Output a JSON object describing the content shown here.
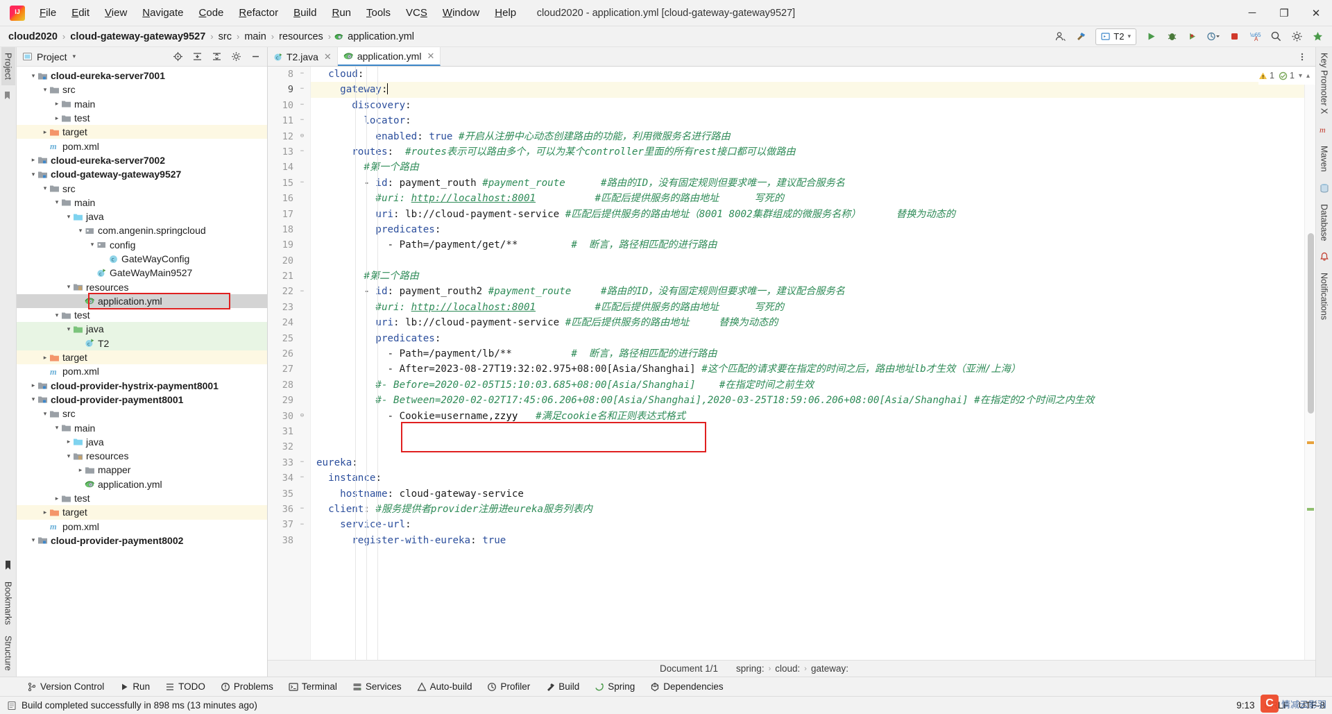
{
  "window": {
    "title": "cloud2020 - application.yml [cloud-gateway-gateway9527]",
    "minimize": "─",
    "maximize": "❐",
    "close": "✕"
  },
  "menubar": [
    {
      "label": "File"
    },
    {
      "label": "Edit"
    },
    {
      "label": "View"
    },
    {
      "label": "Navigate"
    },
    {
      "label": "Code"
    },
    {
      "label": "Refactor"
    },
    {
      "label": "Build"
    },
    {
      "label": "Run"
    },
    {
      "label": "Tools"
    },
    {
      "label": "VCS"
    },
    {
      "label": "Window"
    },
    {
      "label": "Help"
    }
  ],
  "breadcrumb": {
    "items": [
      "cloud2020",
      "cloud-gateway-gateway9527",
      "src",
      "main",
      "resources",
      "application.yml"
    ],
    "separator": "›"
  },
  "toolbar": {
    "run_config": "T2",
    "run_config_caret": "▾",
    "icons": [
      "user-icon",
      "hammer-icon",
      "run-icon",
      "debug-icon",
      "coverage-icon",
      "profile-icon",
      "stop-icon",
      "translate-icon",
      "search-icon",
      "settings-icon",
      "updates-icon"
    ]
  },
  "left_strip": {
    "tabs": [
      {
        "label": "Project",
        "active": true
      }
    ],
    "bottom_tabs": [
      {
        "label": "Bookmarks"
      },
      {
        "label": "Structure"
      }
    ]
  },
  "right_strip": {
    "tabs": [
      {
        "label": "Key Promoter X"
      },
      {
        "label": "Maven"
      },
      {
        "label": "Database"
      },
      {
        "label": "Notifications"
      }
    ]
  },
  "project_panel": {
    "title": "Project",
    "caret": "▾",
    "actions": [
      "locate-icon",
      "expand-all-icon",
      "collapse-all-icon",
      "settings-icon",
      "hide-icon"
    ],
    "tree": [
      {
        "indent": 1,
        "arrow": "⌄",
        "icon": "module-icon",
        "label": "cloud-eureka-server7001",
        "bold": true
      },
      {
        "indent": 2,
        "arrow": "⌄",
        "icon": "folder-gray",
        "label": "src"
      },
      {
        "indent": 3,
        "arrow": "›",
        "icon": "folder-gray",
        "label": "main"
      },
      {
        "indent": 3,
        "arrow": "›",
        "icon": "folder-gray",
        "label": "test"
      },
      {
        "indent": 2,
        "arrow": "›",
        "icon": "folder-orange",
        "label": "target",
        "highlight": "yellow"
      },
      {
        "indent": 2,
        "arrow": "",
        "icon": "maven-icon",
        "label": "pom.xml"
      },
      {
        "indent": 1,
        "arrow": "›",
        "icon": "module-icon",
        "label": "cloud-eureka-server7002",
        "bold": true
      },
      {
        "indent": 1,
        "arrow": "⌄",
        "icon": "module-icon",
        "label": "cloud-gateway-gateway9527",
        "bold": true
      },
      {
        "indent": 2,
        "arrow": "⌄",
        "icon": "folder-gray",
        "label": "src"
      },
      {
        "indent": 3,
        "arrow": "⌄",
        "icon": "folder-gray",
        "label": "main"
      },
      {
        "indent": 4,
        "arrow": "⌄",
        "icon": "folder-blue",
        "label": "java"
      },
      {
        "indent": 5,
        "arrow": "⌄",
        "icon": "package-icon",
        "label": "com.angenin.springcloud"
      },
      {
        "indent": 6,
        "arrow": "⌄",
        "icon": "package-icon",
        "label": "config"
      },
      {
        "indent": 7,
        "arrow": "",
        "icon": "class-icon",
        "label": "GateWayConfig"
      },
      {
        "indent": 6,
        "arrow": "",
        "icon": "class-run-icon",
        "label": "GateWayMain9527"
      },
      {
        "indent": 4,
        "arrow": "⌄",
        "icon": "resources-icon",
        "label": "resources"
      },
      {
        "indent": 5,
        "arrow": "",
        "icon": "yml-icon",
        "label": "application.yml",
        "selected": true,
        "boxed": true
      },
      {
        "indent": 3,
        "arrow": "⌄",
        "icon": "folder-gray",
        "label": "test"
      },
      {
        "indent": 4,
        "arrow": "⌄",
        "icon": "folder-green",
        "label": "java",
        "highlight": "green"
      },
      {
        "indent": 5,
        "arrow": "",
        "icon": "class-run-icon",
        "label": "T2",
        "highlight": "green"
      },
      {
        "indent": 2,
        "arrow": "›",
        "icon": "folder-orange",
        "label": "target",
        "highlight": "yellow"
      },
      {
        "indent": 2,
        "arrow": "",
        "icon": "maven-icon",
        "label": "pom.xml"
      },
      {
        "indent": 1,
        "arrow": "›",
        "icon": "module-icon",
        "label": "cloud-provider-hystrix-payment8001",
        "bold": true
      },
      {
        "indent": 1,
        "arrow": "⌄",
        "icon": "module-icon",
        "label": "cloud-provider-payment8001",
        "bold": true
      },
      {
        "indent": 2,
        "arrow": "⌄",
        "icon": "folder-gray",
        "label": "src"
      },
      {
        "indent": 3,
        "arrow": "⌄",
        "icon": "folder-gray",
        "label": "main"
      },
      {
        "indent": 4,
        "arrow": "›",
        "icon": "folder-blue",
        "label": "java"
      },
      {
        "indent": 4,
        "arrow": "⌄",
        "icon": "resources-icon",
        "label": "resources"
      },
      {
        "indent": 5,
        "arrow": "›",
        "icon": "folder-gray",
        "label": "mapper"
      },
      {
        "indent": 5,
        "arrow": "",
        "icon": "yml-icon",
        "label": "application.yml"
      },
      {
        "indent": 3,
        "arrow": "›",
        "icon": "folder-gray",
        "label": "test"
      },
      {
        "indent": 2,
        "arrow": "›",
        "icon": "folder-orange",
        "label": "target",
        "highlight": "yellow"
      },
      {
        "indent": 2,
        "arrow": "",
        "icon": "maven-icon",
        "label": "pom.xml"
      },
      {
        "indent": 1,
        "arrow": "⌄",
        "icon": "module-icon",
        "label": "cloud-provider-payment8002",
        "bold": true
      }
    ]
  },
  "editor": {
    "tabs": [
      {
        "label": "T2.java",
        "icon": "class-run-icon",
        "active": false,
        "close": "✕"
      },
      {
        "label": "application.yml",
        "icon": "yml-icon",
        "active": true,
        "close": "✕"
      }
    ],
    "inspections": {
      "warnings": "1",
      "weak_warnings": "1",
      "warn_icon": "warning-triangle",
      "weak_icon": "weak-warning"
    },
    "first_line_number": 8,
    "current_line": 9,
    "lines": [
      {
        "n": 8,
        "fold": "−",
        "text": "  cloud:",
        "cut_top": true,
        "spans": [
          {
            "t": "  ",
            "c": "v"
          },
          {
            "t": "cloud",
            "c": "k"
          },
          {
            "t": ":",
            "c": "v"
          }
        ]
      },
      {
        "n": 9,
        "fold": "−",
        "current": true,
        "spans": [
          {
            "t": "    ",
            "c": "v"
          },
          {
            "t": "gateway",
            "c": "k"
          },
          {
            "t": ":",
            "c": "v"
          },
          {
            "t": "",
            "c": "caret"
          }
        ]
      },
      {
        "n": 10,
        "fold": "−",
        "spans": [
          {
            "t": "      ",
            "c": "v"
          },
          {
            "t": "discovery",
            "c": "k"
          },
          {
            "t": ":",
            "c": "v"
          }
        ]
      },
      {
        "n": 11,
        "fold": "−",
        "spans": [
          {
            "t": "        ",
            "c": "v"
          },
          {
            "t": "locator",
            "c": "k"
          },
          {
            "t": ":",
            "c": "v"
          }
        ]
      },
      {
        "n": 12,
        "fold": "⊖",
        "spans": [
          {
            "t": "          ",
            "c": "v"
          },
          {
            "t": "enabled",
            "c": "k"
          },
          {
            "t": ": ",
            "c": "v"
          },
          {
            "t": "true",
            "c": "k"
          },
          {
            "t": " ",
            "c": "v"
          },
          {
            "t": "#开启从注册中心动态创建路由的功能，利用微服务名进行路由",
            "c": "c"
          }
        ]
      },
      {
        "n": 13,
        "fold": "−",
        "spans": [
          {
            "t": "      ",
            "c": "v"
          },
          {
            "t": "routes",
            "c": "k"
          },
          {
            "t": ":  ",
            "c": "v"
          },
          {
            "t": "#routes表示可以路由多个，可以为某个controller里面的所有rest接口都可以做路由",
            "c": "c"
          }
        ]
      },
      {
        "n": 14,
        "fold": "",
        "spans": [
          {
            "t": "        ",
            "c": "v"
          },
          {
            "t": "#第一个路由",
            "c": "c"
          }
        ]
      },
      {
        "n": 15,
        "fold": "−",
        "spans": [
          {
            "t": "        - ",
            "c": "v"
          },
          {
            "t": "id",
            "c": "k"
          },
          {
            "t": ": payment_routh ",
            "c": "v"
          },
          {
            "t": "#payment_route",
            "c": "c"
          },
          {
            "t": "      ",
            "c": "v"
          },
          {
            "t": "#路由的ID，没有固定规则但要求唯一，建议配合服务名",
            "c": "c"
          }
        ]
      },
      {
        "n": 16,
        "fold": "",
        "spans": [
          {
            "t": "          ",
            "c": "v"
          },
          {
            "t": "#uri: ",
            "c": "c"
          },
          {
            "t": "http://localhost:8001",
            "c": "u"
          },
          {
            "t": "          ",
            "c": "v"
          },
          {
            "t": "#匹配后提供服务的路由地址      写死的",
            "c": "c"
          }
        ]
      },
      {
        "n": 17,
        "fold": "",
        "spans": [
          {
            "t": "          ",
            "c": "v"
          },
          {
            "t": "uri",
            "c": "k"
          },
          {
            "t": ": lb://cloud-payment-service ",
            "c": "v"
          },
          {
            "t": "#匹配后提供服务的路由地址（8001 8002集群组成的微服务名称）      替换为动态的",
            "c": "c"
          }
        ]
      },
      {
        "n": 18,
        "fold": "",
        "spans": [
          {
            "t": "          ",
            "c": "v"
          },
          {
            "t": "predicates",
            "c": "k"
          },
          {
            "t": ":",
            "c": "v"
          }
        ]
      },
      {
        "n": 19,
        "fold": "",
        "spans": [
          {
            "t": "            - ",
            "c": "v"
          },
          {
            "t": "Path=/payment/get/**",
            "c": "v"
          },
          {
            "t": "         ",
            "c": "v"
          },
          {
            "t": "#  断言，路径相匹配的进行路由",
            "c": "c"
          }
        ]
      },
      {
        "n": 20,
        "fold": "",
        "spans": []
      },
      {
        "n": 21,
        "fold": "",
        "spans": [
          {
            "t": "        ",
            "c": "v"
          },
          {
            "t": "#第二个路由",
            "c": "c"
          }
        ]
      },
      {
        "n": 22,
        "fold": "−",
        "spans": [
          {
            "t": "        - ",
            "c": "v"
          },
          {
            "t": "id",
            "c": "k"
          },
          {
            "t": ": payment_routh2 ",
            "c": "v"
          },
          {
            "t": "#payment_route",
            "c": "c"
          },
          {
            "t": "     ",
            "c": "v"
          },
          {
            "t": "#路由的ID，没有固定规则但要求唯一，建议配合服务名",
            "c": "c"
          }
        ]
      },
      {
        "n": 23,
        "fold": "",
        "spans": [
          {
            "t": "          ",
            "c": "v"
          },
          {
            "t": "#uri: ",
            "c": "c"
          },
          {
            "t": "http://localhost:8001",
            "c": "u"
          },
          {
            "t": "          ",
            "c": "v"
          },
          {
            "t": "#匹配后提供服务的路由地址      写死的",
            "c": "c"
          }
        ]
      },
      {
        "n": 24,
        "fold": "",
        "spans": [
          {
            "t": "          ",
            "c": "v"
          },
          {
            "t": "uri",
            "c": "k"
          },
          {
            "t": ": lb://cloud-payment-service ",
            "c": "v"
          },
          {
            "t": "#匹配后提供服务的路由地址     替换为动态的",
            "c": "c"
          }
        ]
      },
      {
        "n": 25,
        "fold": "",
        "spans": [
          {
            "t": "          ",
            "c": "v"
          },
          {
            "t": "predicates",
            "c": "k"
          },
          {
            "t": ":",
            "c": "v"
          }
        ]
      },
      {
        "n": 26,
        "fold": "",
        "spans": [
          {
            "t": "            - ",
            "c": "v"
          },
          {
            "t": "Path=/payment/lb/**",
            "c": "v"
          },
          {
            "t": "          ",
            "c": "v"
          },
          {
            "t": "#  断言，路径相匹配的进行路由",
            "c": "c"
          }
        ]
      },
      {
        "n": 27,
        "fold": "",
        "spans": [
          {
            "t": "            - ",
            "c": "v"
          },
          {
            "t": "After=2023-08-27T19:32:02.975+08:00[Asia/Shanghai]",
            "c": "v"
          },
          {
            "t": " ",
            "c": "v"
          },
          {
            "t": "#这个匹配的请求要在指定的时间之后，路由地址lb才生效（亚洲/上海）",
            "c": "c"
          }
        ]
      },
      {
        "n": 28,
        "fold": "",
        "spans": [
          {
            "t": "          ",
            "c": "v"
          },
          {
            "t": "#- Before=2020-02-05T15:10:03.685+08:00[Asia/Shanghai]",
            "c": "c"
          },
          {
            "t": "    ",
            "c": "v"
          },
          {
            "t": "#在指定时间之前生效",
            "c": "c"
          }
        ]
      },
      {
        "n": 29,
        "fold": "",
        "spans": [
          {
            "t": "          ",
            "c": "v"
          },
          {
            "t": "#- Between=2020-02-02T17:45:06.206+08:00[Asia/Shanghai],2020-03-25T18:59:06.206+08:00[Asia/Shanghai]",
            "c": "c"
          },
          {
            "t": " ",
            "c": "v"
          },
          {
            "t": "#在指定的2个时间之内生效",
            "c": "c"
          }
        ]
      },
      {
        "n": 30,
        "fold": "⊖",
        "spans": [
          {
            "t": "            - ",
            "c": "v"
          },
          {
            "t": "Cookie=username,",
            "c": "v"
          },
          {
            "t": "zzyy",
            "c": "wavy"
          },
          {
            "t": "   ",
            "c": "v"
          },
          {
            "t": "#满足cookie名和正则表达式格式",
            "c": "c"
          }
        ]
      },
      {
        "n": 31,
        "fold": "",
        "spans": []
      },
      {
        "n": 32,
        "fold": "",
        "spans": []
      },
      {
        "n": 33,
        "fold": "−",
        "spans": [
          {
            "t": "",
            "c": "v"
          },
          {
            "t": "eureka",
            "c": "k"
          },
          {
            "t": ":",
            "c": "v"
          }
        ]
      },
      {
        "n": 34,
        "fold": "−",
        "spans": [
          {
            "t": "  ",
            "c": "v"
          },
          {
            "t": "instance",
            "c": "k"
          },
          {
            "t": ":",
            "c": "v"
          }
        ]
      },
      {
        "n": 35,
        "fold": "",
        "spans": [
          {
            "t": "    ",
            "c": "v"
          },
          {
            "t": "hostname",
            "c": "k"
          },
          {
            "t": ": cloud-gateway-service",
            "c": "v"
          }
        ]
      },
      {
        "n": 36,
        "fold": "−",
        "spans": [
          {
            "t": "  ",
            "c": "v"
          },
          {
            "t": "client",
            "c": "k"
          },
          {
            "t": ": ",
            "c": "v"
          },
          {
            "t": "#服务提供者provider注册进eureka服务列表内",
            "c": "c"
          }
        ]
      },
      {
        "n": 37,
        "fold": "−",
        "spans": [
          {
            "t": "    ",
            "c": "v"
          },
          {
            "t": "service-url",
            "c": "k"
          },
          {
            "t": ":",
            "c": "v"
          }
        ]
      },
      {
        "n": 38,
        "fold": "",
        "spans": [
          {
            "t": "      ",
            "c": "v"
          },
          {
            "t": "register-with-eureka",
            "c": "k"
          },
          {
            "t": ": ",
            "c": "v"
          },
          {
            "t": "true",
            "c": "k"
          }
        ]
      }
    ]
  },
  "docbar": {
    "document": "Document 1/1",
    "path": [
      "spring:",
      "cloud:",
      "gateway:"
    ],
    "separator": "›"
  },
  "tool_windows": [
    {
      "label": "Version Control",
      "icon": "branch-icon"
    },
    {
      "label": "Run",
      "icon": "run-icon"
    },
    {
      "label": "TODO",
      "icon": "todo-icon"
    },
    {
      "label": "Problems",
      "icon": "problems-icon"
    },
    {
      "label": "Terminal",
      "icon": "terminal-icon"
    },
    {
      "label": "Services",
      "icon": "services-icon"
    },
    {
      "label": "Auto-build",
      "icon": "autobuild-icon"
    },
    {
      "label": "Profiler",
      "icon": "profiler-icon"
    },
    {
      "label": "Build",
      "icon": "build-icon"
    },
    {
      "label": "Spring",
      "icon": "spring-icon"
    },
    {
      "label": "Dependencies",
      "icon": "dependencies-icon"
    }
  ],
  "statusbar": {
    "message": "Build completed successfully in 898 ms (13 minutes ago)",
    "caret_position": "9:13",
    "line_separator": "CRLF",
    "encoding": "UTF-8",
    "watermark": "情减云影羽"
  }
}
